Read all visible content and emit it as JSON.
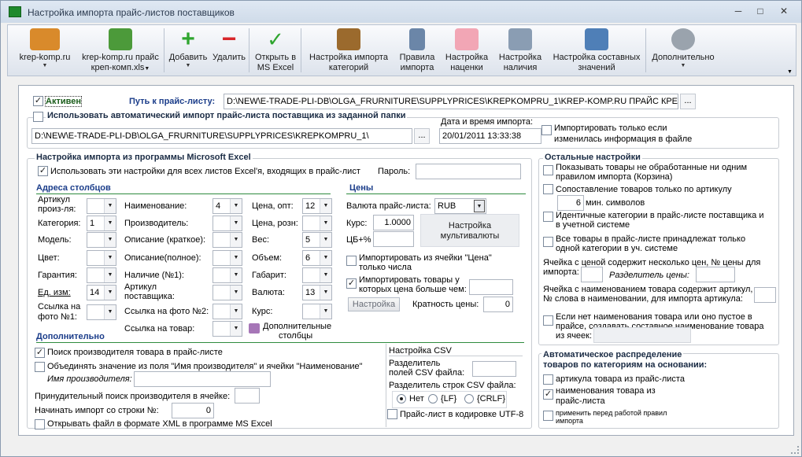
{
  "window": {
    "title": "Настройка импорта прайс-листов поставщиков"
  },
  "toolbar": {
    "krep": "krep-komp.ru",
    "krep_price_1": "krep-komp.ru прайс",
    "krep_price_2": "креп-комп.xls",
    "add": "Добавить",
    "delete": "Удалить",
    "open_excel_1": "Открыть в",
    "open_excel_2": "MS Excel",
    "cat_import_1": "Настройка импорта",
    "cat_import_2": "категорий",
    "rules_1": "Правила",
    "rules_2": "импорта",
    "markup_1": "Настройка",
    "markup_2": "наценки",
    "avail_1": "Настройка",
    "avail_2": "наличия",
    "composite_1": "Настройка составных",
    "composite_2": "значений",
    "more": "Дополнительно"
  },
  "top": {
    "active": "Активен",
    "path_label": "Путь к прайс-листу:",
    "path_value": "D:\\NEW\\E-TRADE-PLI-DB\\OLGA_FRURNITURE\\SUPPLYPRICES\\KREPKOMPRU_1\\KREP-KOMP.RU ПРАЙС КРЕП-КОМП.X",
    "auto_import": "Использовать автоматический импорт прайс-листа поставщика из заданной папки",
    "folder_value": "D:\\NEW\\E-TRADE-PLI-DB\\OLGA_FRURNITURE\\SUPPLYPRICES\\KREPKOMPRU_1\\",
    "datetime_label": "Дата и время импорта:",
    "datetime_value": "20/01/2011 13:33:38",
    "only_changed_1": "Импортировать только если",
    "only_changed_2": "изменилась информация в файле",
    "ellipsis": "..."
  },
  "excel": {
    "title": "Настройка импорта из программы Microsoft Excel",
    "all_sheets": "Использовать эти настройки для всех листов Excel'я, входящих в прайс-лист",
    "password": "Пароль:",
    "col_addr": "Адреса столбцов",
    "prices": "Цены",
    "article_1": "Артикул",
    "article_2": "произ-ля:",
    "category": "Категория:",
    "category_v": "1",
    "model": "Модель:",
    "color": "Цвет:",
    "warranty": "Гарантия:",
    "unit": "Ед. изм:",
    "unit_v": "14",
    "photo1_1": "Ссылка на",
    "photo1_2": "фото №1:",
    "name": "Наименование:",
    "name_v": "4",
    "manufacturer": "Производитель:",
    "desc_short": "Описание (краткое):",
    "desc_full": "Описание(полное):",
    "avail1": "Наличие (№1):",
    "supplier_art_1": "Артикул",
    "supplier_art_2": "поставщика:",
    "photo2": "Ссылка на фото №2:",
    "product_link": "Ссылка на товар:",
    "price_wholesale": "Цена, опт:",
    "price_wholesale_v": "12",
    "price_retail": "Цена, розн:",
    "weight": "Вес:",
    "weight_v": "5",
    "volume": "Объем:",
    "volume_v": "6",
    "size": "Габарит:",
    "currency": "Валюта:",
    "currency_v": "13",
    "rate": "Курс:",
    "extra_cols_1": "Дополнительные",
    "extra_cols_2": "столбцы",
    "price_currency": "Валюта прайс-листа:",
    "price_currency_v": "RUB",
    "rate_label": "Курс:",
    "rate_value": "1.0000",
    "cb_pct": "ЦБ+%",
    "multicurrency_1": "Настройка",
    "multicurrency_2": "мультивалюты",
    "from_price_cell_1": "Импортировать из ячейки \"Цена\"",
    "from_price_cell_2": "только числа",
    "price_greater_1": "Импортировать товары у",
    "price_greater_2": "которых цена больше чем:",
    "setting_btn": "Настройка",
    "price_multiplicity": "Кратность цены:",
    "price_multiplicity_v": "0"
  },
  "additional": {
    "title": "Дополнительно",
    "search_manufacturer": "Поиск производителя товара в прайс-листе",
    "merge_name": "Объединять значение из поля \"Имя производителя\" и ячейки \"Наименование\"",
    "manufacturer_name": "Имя производителя:",
    "forced_search": "Принудительный поиск производителя в ячейке:",
    "start_row": "Начинать импорт со строки №:",
    "start_row_v": "0",
    "open_xml": "Открывать файл в формате XML в программе MS Excel",
    "csv_title": "Настройка CSV",
    "csv_field_sep_1": "Разделитель",
    "csv_field_sep_2": "полей CSV файла:",
    "csv_row_sep": "Разделитель строк CSV файла:",
    "no": "Нет",
    "lf": "{LF}",
    "crlf": "{CRLF}",
    "utf8": "Прайс-лист в кодировке UTF-8"
  },
  "other": {
    "title": "Остальные настройки",
    "show_unprocessed_1": "Показывать товары не обработанные ни одним",
    "show_unprocessed_2": "правилом импорта (Корзина)",
    "match_article": "Сопоставление товаров только по артикулу",
    "min_chars_v": "6",
    "min_chars": "мин. символов",
    "identical_cats_1": "Идентичные категории в прайс-листе поставщика и",
    "identical_cats_2": "в учетной системе",
    "one_category_1": "Все товары в прайс-листе принадлежат только",
    "one_category_2": "одной категории в уч. системе",
    "multi_price_1": "Ячейка с ценой содержит несколько цен, № цены для",
    "multi_price_2": "импорта:",
    "price_sep": "Разделитель цены:",
    "article_word_1": "Ячейка с наименованием товара содержит артикул,",
    "article_word_2": "№ слова в наименовании, для импорта артикула:",
    "composite_1": "Если нет наименования товара или оно пустое в",
    "composite_2": "прайсе, создавать составное наименование товара",
    "composite_3": "из ячеек:"
  },
  "auto_dist": {
    "title_1": "Автоматическое распределение",
    "title_2": "товаров по категориям на основании:",
    "by_article": "артикула товара из прайс-листа",
    "by_name_1": "наименования товара из",
    "by_name_2": "прайс-листа",
    "apply_rules_1": "применить перед работой правил",
    "apply_rules_2": "импорта"
  },
  "glyphs": {
    "check": "✓",
    "arrow": "▼",
    "minimize": "─",
    "maximize": "□",
    "close": "✕"
  }
}
